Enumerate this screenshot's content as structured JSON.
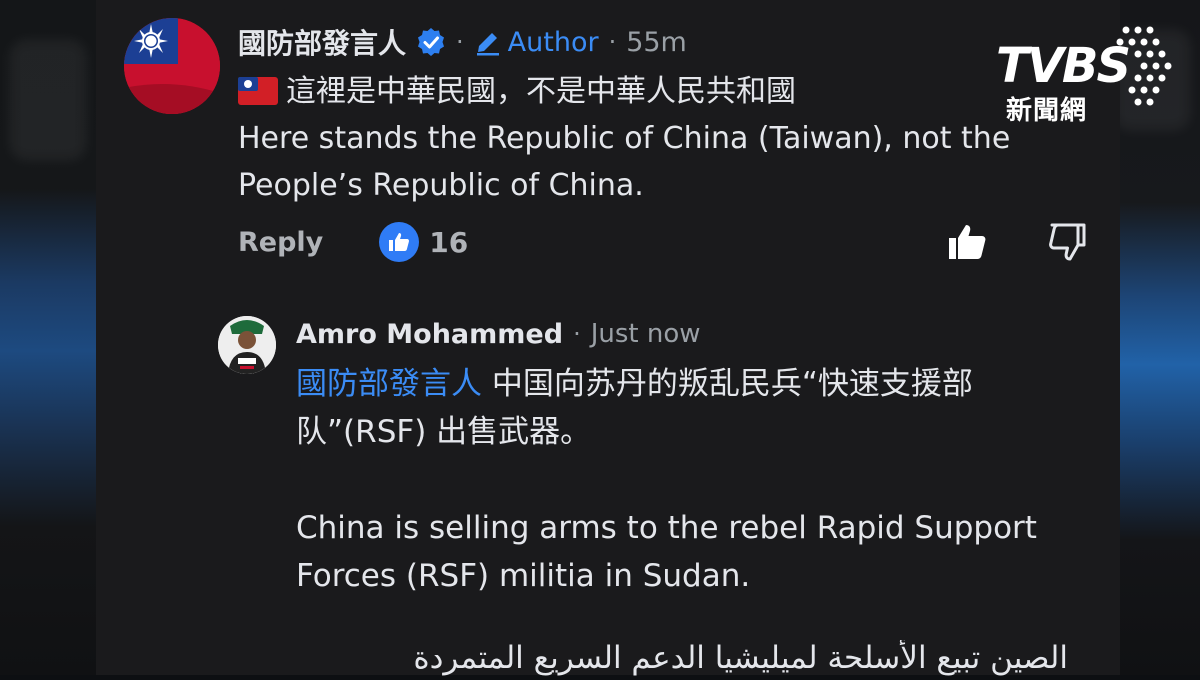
{
  "top_comment": {
    "author_name": "國防部發言人",
    "author_badge": "Author",
    "separator": "·",
    "time": "55m",
    "text_line_1": "這裡是中華民國，不是中華人民共和國",
    "text_line_2": "Here stands the Republic of China (Taiwan), not the",
    "text_line_3": "People’s Republic of China.",
    "reply_label": "Reply",
    "like_count": "16"
  },
  "reply_comment": {
    "author_name": "Amro Mohammed",
    "separator": "·",
    "time": "Just now",
    "mention": "國防部發言人",
    "text_cn_1": " 中国向苏丹的叛乱民兵“快速支援部",
    "text_cn_2": "队”(RSF) 出售武器。",
    "text_en_1": "China is selling arms to the rebel Rapid Support",
    "text_en_2": "Forces (RSF) militia in Sudan.",
    "text_ar": "الصين تبيع الأسلحة لميليشيا الدعم السريع المتمردة"
  },
  "watermark": {
    "brand": "TVBS",
    "sub": "新聞網"
  },
  "colors": {
    "accent": "#3b8cf5",
    "background": "#1a1a1c",
    "text": "#e4e6eb",
    "muted": "#9aa0a6"
  }
}
